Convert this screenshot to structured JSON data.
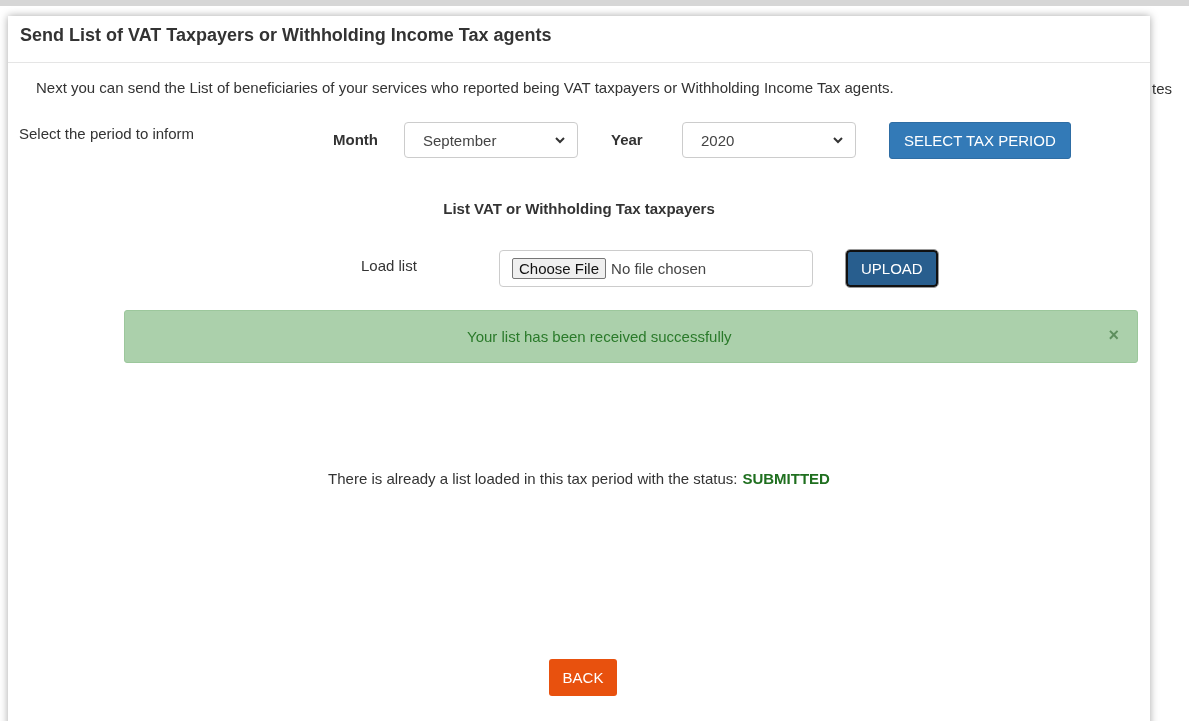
{
  "dialog": {
    "title": "Send List of VAT Taxpayers or Withholding Income Tax agents",
    "intro": "Next you can send the List of beneficiaries of your services who reported being VAT taxpayers or Withholding Income Tax agents.",
    "period": {
      "label": "Select the period to inform",
      "month_label": "Month",
      "month_value": "September",
      "year_label": "Year",
      "year_value": "2020",
      "button": "SELECT TAX PERIOD"
    },
    "list_heading": "List VAT or Withholding Tax taxpayers",
    "load": {
      "label": "Load list",
      "choose_button": "Choose File",
      "file_status": "No file chosen",
      "upload_button": "UPLOAD"
    },
    "alert": {
      "message": "Your list has been received successfully",
      "close": "×"
    },
    "status": {
      "text": "There is already a list loaded in this tax period with the status:",
      "value": "SUBMITTED"
    },
    "back_button": "BACK"
  },
  "background_text": "tes"
}
